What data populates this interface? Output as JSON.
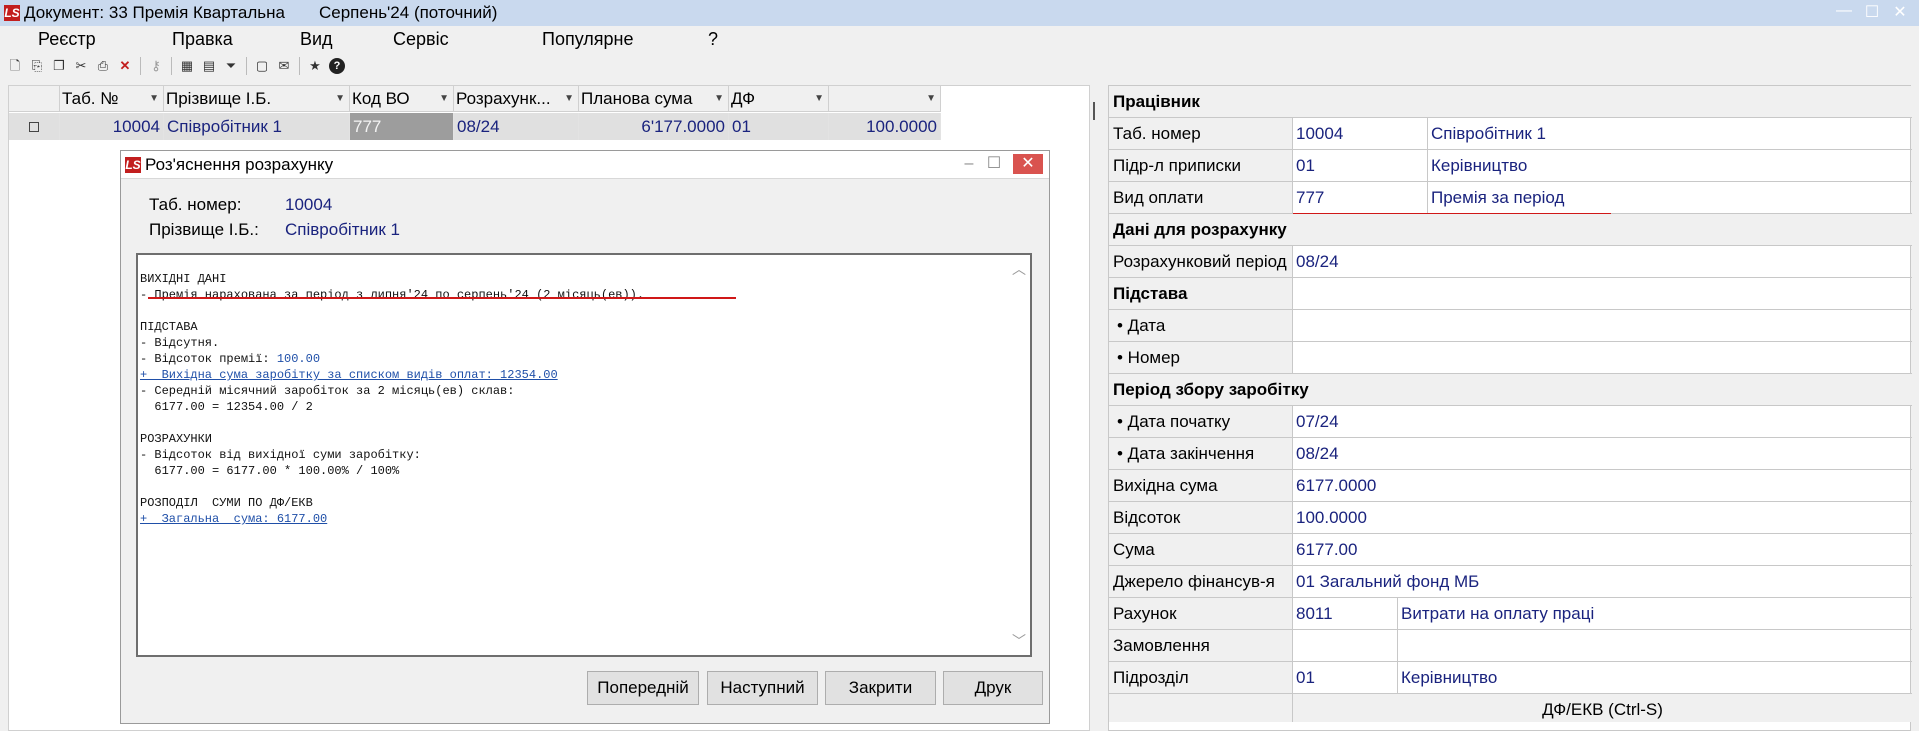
{
  "titlebar": {
    "icon": "LS",
    "doc_title": "Документ: 33 Премія Квартальна",
    "period": "Серпень'24 (поточний)",
    "minimize": "—",
    "maximize": "☐",
    "close": "✕"
  },
  "menu": [
    "Реєстр",
    "Правка",
    "Вид",
    "Сервіс",
    "Популярне",
    "?"
  ],
  "toolbar_icons": [
    "new-doc-icon",
    "new-folder-icon",
    "copy-icon",
    "cut-icon",
    "print-icon",
    "delete-icon",
    "key-icon",
    "table-icon",
    "filter-icon",
    "calc-icon",
    "mail-icon",
    "star-icon",
    "help-icon"
  ],
  "grid": {
    "headers": [
      "Таб. №",
      "Прізвище І.Б.",
      "Код ВО",
      "Розрахунк...",
      "Планова сума",
      "ДФ",
      ""
    ],
    "row": {
      "tab": "10004",
      "name": "Співробітник 1",
      "code": "777",
      "period": "08/24",
      "plan_sum": "6'177.0000",
      "df": "01",
      "amount": "100.0000"
    }
  },
  "dialog": {
    "title": "Роз'яснення розрахунку",
    "tab_label": "Таб. номер:",
    "tab_value": "10004",
    "name_label": "Прізвище І.Б.:",
    "name_value": "Співробітник 1",
    "lines": {
      "l1": "ВИХІДНІ ДАНІ",
      "l2": "- Премія нарахована за період з липня'24 по серпень'24 (2 місяць(ев)).",
      "l3": "ПІДСТАВА",
      "l4": "- Відсутня.",
      "l5a": "- Відсоток премії: ",
      "l5b": "100.00",
      "l6": "+  Вихідна сума заробітку за списком видів оплат: 12354.00",
      "l7": "- Середній місячний заробіток за 2 місяць(ев) склав:",
      "l8": "  6177.00 = 12354.00 / 2",
      "l9": "РОЗРАХУНКИ",
      "l10": "- Відсоток від вихідної суми заробітку:",
      "l11": "  6177.00 = 6177.00 * 100.00% / 100%",
      "l12": "РОЗПОДІЛ  СУМИ ПО ДФ/ЕКВ",
      "l13": "+  Загальна  сума: 6177.00"
    },
    "buttons": {
      "prev": "Попередній",
      "next": "Наступний",
      "close": "Закрити",
      "print": "Друк"
    }
  },
  "props": {
    "section_worker": "Працівник",
    "tab_label": "Таб. номер",
    "tab_code": "10004",
    "tab_name": "Співробітник 1",
    "dept_label": "Підр-л приписки",
    "dept_code": "01",
    "dept_name": "Керівництво",
    "paytype_label": "Вид оплати",
    "paytype_code": "777",
    "paytype_name": "Премія за період",
    "section_calc": "Дані для розрахунку",
    "calc_period_label": "Розрахунковий період",
    "calc_period_value": "08/24",
    "section_basis": "Підстава",
    "date_label": "• Дата",
    "number_label": "• Номер",
    "section_collect": "Період збору заробітку",
    "start_label": "• Дата початку",
    "start_value": "07/24",
    "end_label": "• Дата закінчення",
    "end_value": "08/24",
    "base_label": "Вихідна сума",
    "base_value": "6177.0000",
    "percent_label": "Відсоток",
    "percent_value": "100.0000",
    "sum_label": "Сума",
    "sum_value": "6177.00",
    "source_label": "Джерело фінансув-я",
    "source_value": "01 Загальний фонд МБ",
    "account_label": "Рахунок",
    "account_code": "8011",
    "account_name": "Витрати на оплату праці",
    "order_label": "Замовлення",
    "unit_label": "Підрозділ",
    "unit_code": "01",
    "unit_name": "Керівництво",
    "footer": "ДФ/ЕКВ (Ctrl-S)"
  },
  "colors": {
    "titlebar": "#c9d9ee",
    "value_text": "#1a237e",
    "annotation_red": "#d01818",
    "link_blue": "#1f4fa8"
  }
}
